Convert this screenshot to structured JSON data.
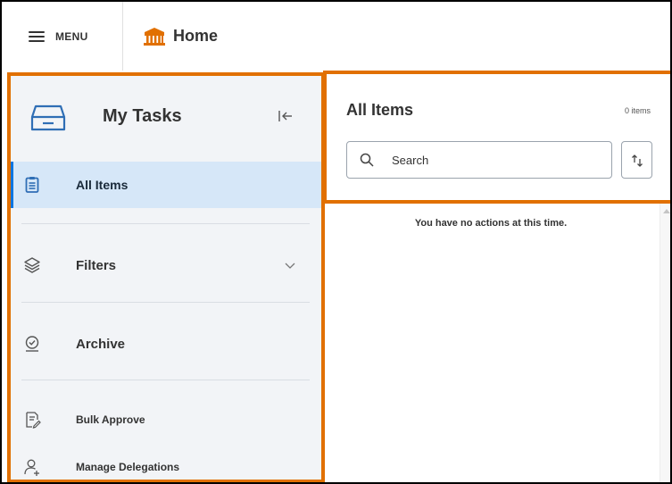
{
  "topbar": {
    "menu_label": "MENU",
    "home_label": "Home"
  },
  "sidebar": {
    "title": "My Tasks",
    "items": [
      {
        "label": "All Items",
        "icon": "clipboard-icon",
        "active": true
      },
      {
        "label": "Filters",
        "icon": "layers-icon",
        "active": false
      },
      {
        "label": "Archive",
        "icon": "archive-check-icon",
        "active": false
      },
      {
        "label": "Bulk Approve",
        "icon": "bulk-approve-icon",
        "active": false
      },
      {
        "label": "Manage Delegations",
        "icon": "delegate-user-icon",
        "active": false
      }
    ]
  },
  "main": {
    "title": "All Items",
    "count_label": "0 items",
    "search": {
      "placeholder": "Search",
      "value": ""
    },
    "empty_message": "You have no actions at this time."
  },
  "colors": {
    "highlight_border": "#e17000",
    "active_bg": "#d6e7f8",
    "active_accent": "#0875e1",
    "sidebar_bg": "#f2f4f7",
    "brand_icon": "#e17000"
  }
}
